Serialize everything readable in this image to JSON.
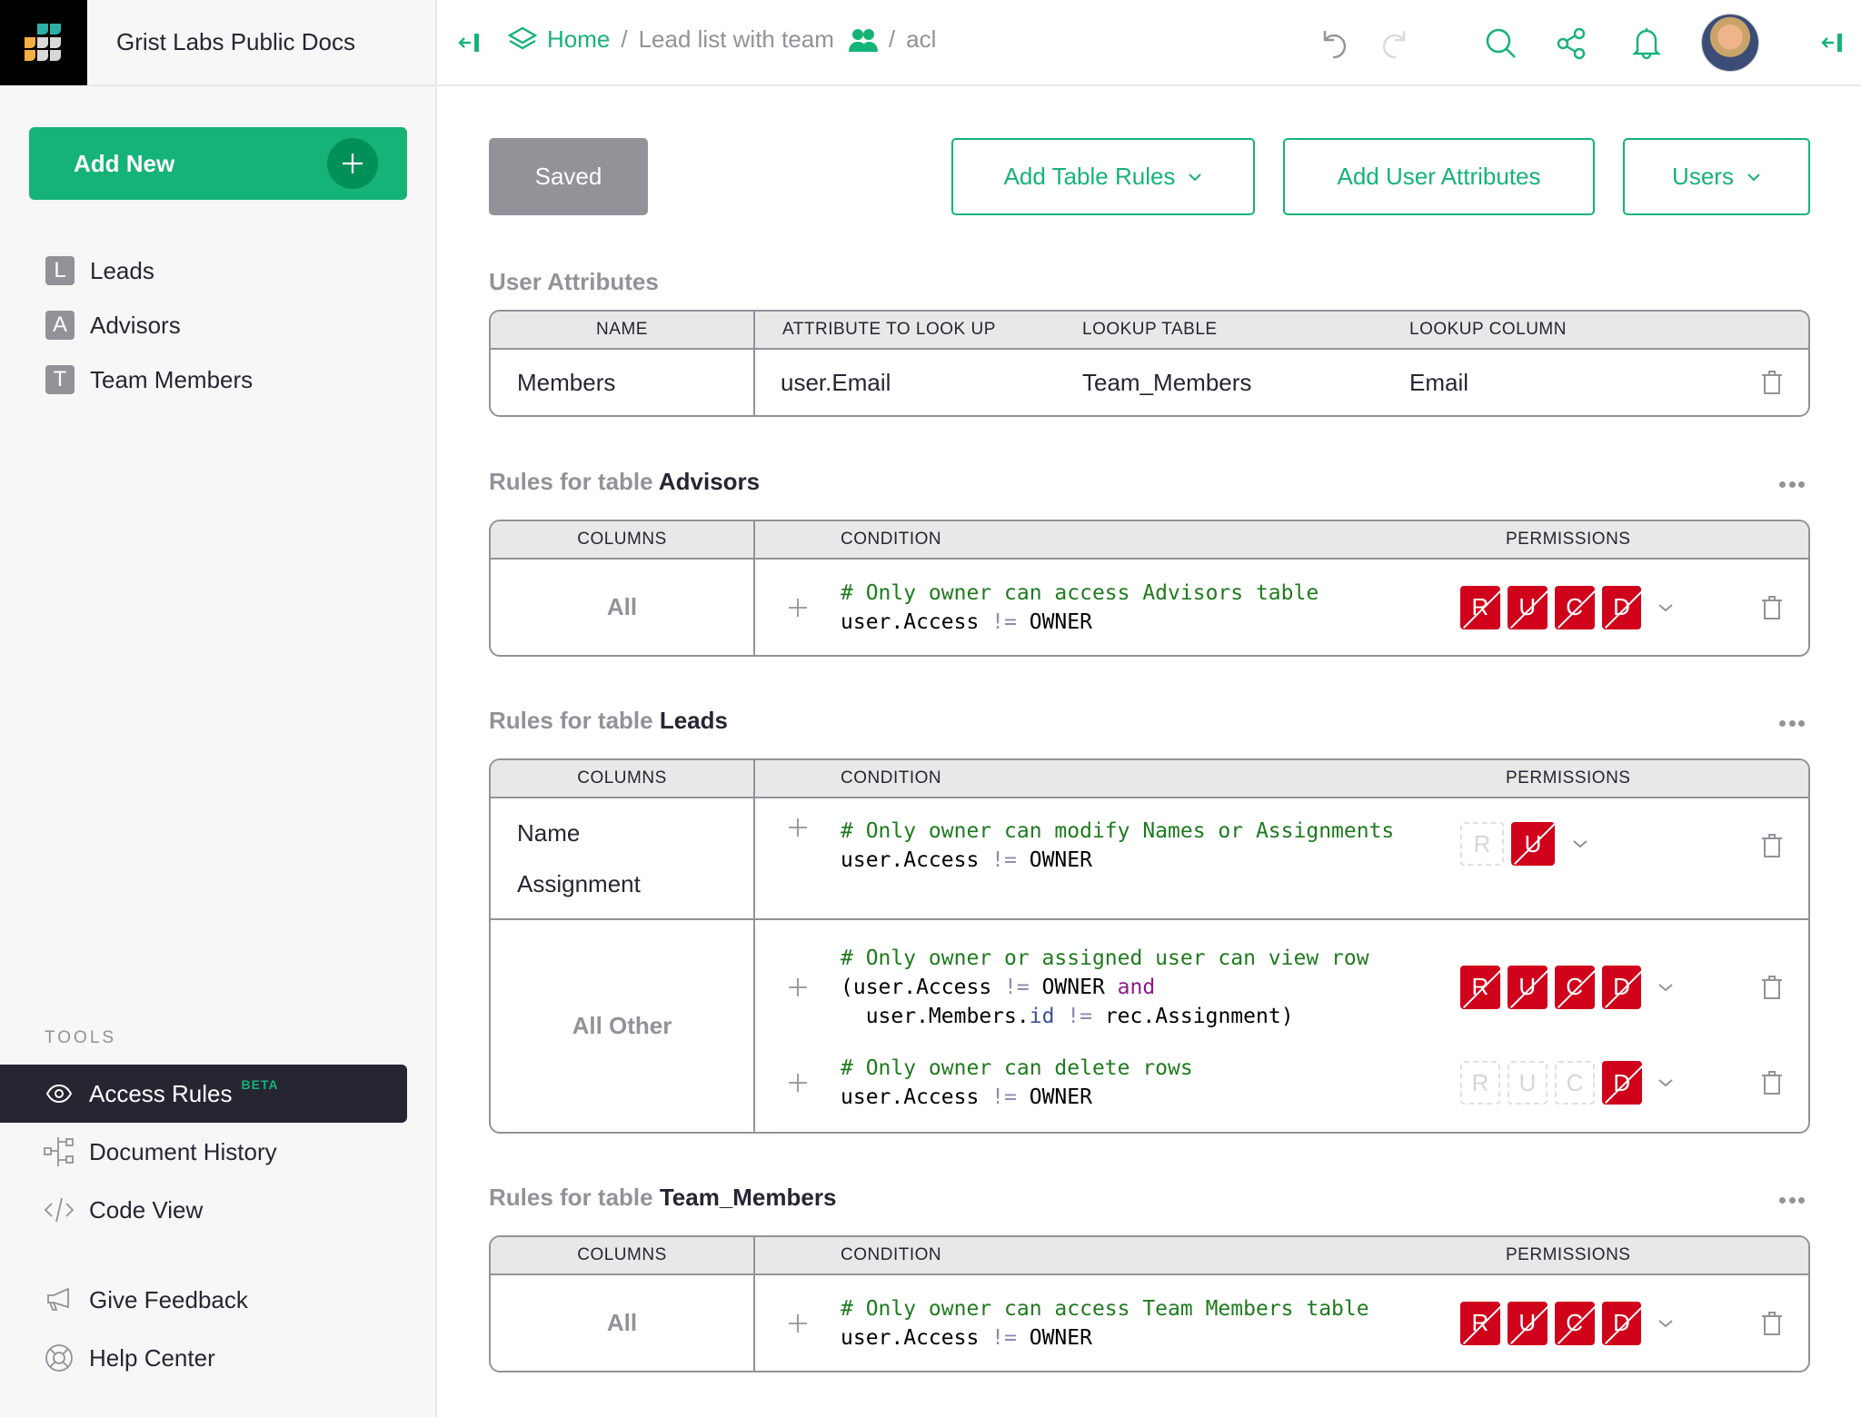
{
  "org": {
    "name": "Grist Labs Public Docs",
    "logo_icon": "grist-logo-icon"
  },
  "topbar": {
    "collapse_left_icon": "collapse-panel-icon",
    "breadcrumb": {
      "home_icon": "layers-icon",
      "home": "Home",
      "separator": "/",
      "document": "Lead list with team",
      "document_icon": "team-users-icon",
      "page": "acl"
    },
    "icons": [
      "undo-icon",
      "redo-icon",
      "search-icon",
      "share-icon",
      "notifications-bell-icon",
      "user-avatar",
      "collapse-right-panel-icon"
    ]
  },
  "sidebar": {
    "add_new": "Add New",
    "pages": [
      {
        "badge": "L",
        "label": "Leads"
      },
      {
        "badge": "A",
        "label": "Advisors"
      },
      {
        "badge": "T",
        "label": "Team Members"
      }
    ],
    "tools_label": "TOOLS",
    "tools": [
      {
        "label": "Access Rules",
        "badge": "BETA",
        "icon": "eye-icon",
        "active": true
      },
      {
        "label": "Document History",
        "icon": "history-tree-icon"
      },
      {
        "label": "Code View",
        "icon": "code-icon"
      }
    ],
    "footer": [
      {
        "label": "Give Feedback",
        "icon": "megaphone-icon"
      },
      {
        "label": "Help Center",
        "icon": "lifebuoy-icon"
      }
    ]
  },
  "toolbar": {
    "saved": "Saved",
    "add_table_rules": "Add Table Rules",
    "add_user_attributes": "Add User Attributes",
    "users": "Users"
  },
  "user_attributes": {
    "title": "User Attributes",
    "headers": [
      "NAME",
      "ATTRIBUTE TO LOOK UP",
      "LOOKUP TABLE",
      "LOOKUP COLUMN"
    ],
    "rows": [
      {
        "name": "Members",
        "attribute": "user.Email",
        "lookup_table": "Team_Members",
        "lookup_column": "Email"
      }
    ]
  },
  "rule_headers": {
    "columns": "COLUMNS",
    "condition": "CONDITION",
    "permissions": "PERMISSIONS"
  },
  "rules_prefix": "Rules for table",
  "tables": [
    {
      "name": "Advisors",
      "groups": [
        {
          "columns": "All",
          "rules": [
            {
              "comment": "# Only owner can access Advisors table",
              "code": "user.Access != OWNER",
              "permissions": {
                "R": "deny",
                "U": "deny",
                "C": "deny",
                "D": "deny"
              }
            }
          ]
        }
      ]
    },
    {
      "name": "Leads",
      "groups": [
        {
          "columns": [
            "Name",
            "Assignment"
          ],
          "rules": [
            {
              "comment": "# Only owner can modify Names or Assignments",
              "code": "user.Access != OWNER",
              "permissions": {
                "R": "unset",
                "U": "deny"
              }
            }
          ]
        },
        {
          "columns": "All Other",
          "rules": [
            {
              "comment": "# Only owner or assigned user can view row",
              "code": "(user.Access != OWNER and\n  user.Members.id != rec.Assignment)",
              "permissions": {
                "R": "deny",
                "U": "deny",
                "C": "deny",
                "D": "deny"
              }
            },
            {
              "comment": "# Only owner can delete rows",
              "code": "user.Access != OWNER",
              "permissions": {
                "R": "unset",
                "U": "unset",
                "C": "unset",
                "D": "deny"
              }
            }
          ]
        }
      ]
    },
    {
      "name": "Team_Members",
      "groups": [
        {
          "columns": "All",
          "rules": [
            {
              "comment": "# Only owner can access Team Members table",
              "code": "user.Access != OWNER",
              "permissions": {
                "R": "deny",
                "U": "deny",
                "C": "deny",
                "D": "deny"
              }
            }
          ]
        }
      ]
    }
  ],
  "colors": {
    "accent": "#16b378",
    "deny": "#d0021b",
    "dark": "#262633",
    "muted": "#929299"
  }
}
